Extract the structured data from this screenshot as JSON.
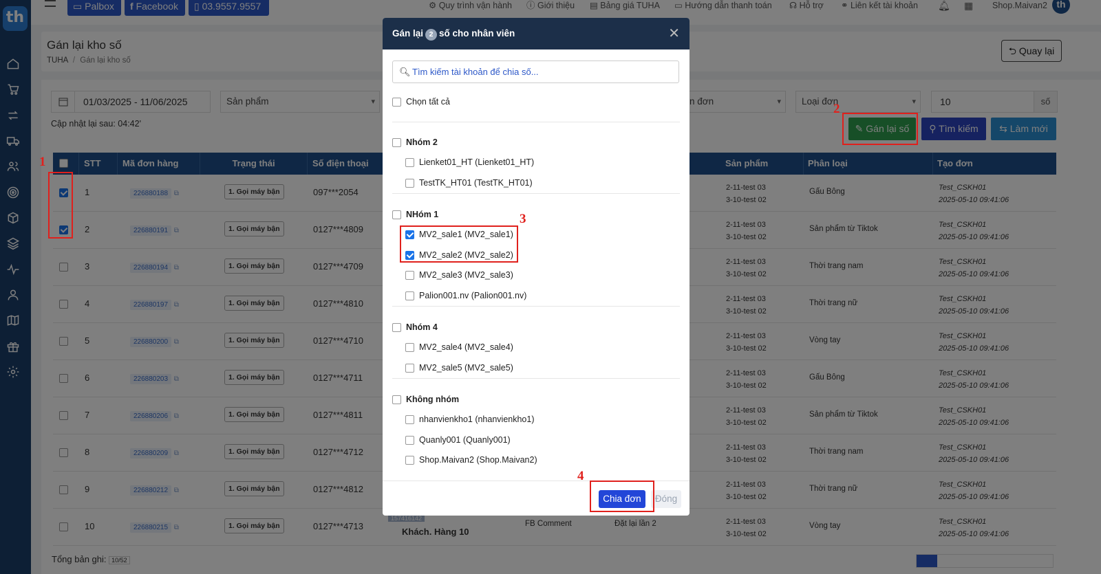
{
  "topbar": {
    "buttons": [
      "Palbox",
      "Facebook",
      "03.9557.9557"
    ],
    "links": [
      "Quy trình vận hành",
      "Giới thiệu",
      "Bảng giá TUHA",
      "Hướng dẫn thanh toán",
      "Hỗ trợ",
      "Liên kết tài khoản"
    ],
    "user": "Shop.Maivan2",
    "user_avatar": "th"
  },
  "sidebar": {
    "logo": "th",
    "icons": [
      "home-icon",
      "cart-icon",
      "exchange-icon",
      "truck-icon",
      "users-icon",
      "target-icon",
      "box-icon",
      "layers-icon",
      "activity-icon",
      "user-icon",
      "map-icon",
      "gift-icon",
      "gear-icon"
    ]
  },
  "page": {
    "title": "Gán lại kho số",
    "breadcrumb_root": "TUHA",
    "breadcrumb_sep": "/",
    "breadcrumb_current": "Gán lại kho số",
    "back_label": "Quay lại"
  },
  "filters": {
    "date_range": "01/03/2025 - 11/06/2025",
    "product_placeholder": "Sản phẩm",
    "order_source_partial": "n đơn",
    "order_type_placeholder": "Loại đơn",
    "count_value": "10",
    "count_suffix": "số",
    "update_text": "Cập nhật lại sau: 04:42'"
  },
  "actions": {
    "reassign": "Gán lại số",
    "search": "Tìm kiếm",
    "reset": "Làm mới"
  },
  "table": {
    "headers": [
      "STT",
      "Mã đơn hàng",
      "Trạng thái",
      "Số điện thoại",
      "Sản phẩm",
      "Phân loại",
      "Tạo đơn"
    ],
    "rows": [
      {
        "stt": "1",
        "code": "226880188",
        "status": "1. Gọi máy bận",
        "phone": "097***2054",
        "prod1": "2-11-test 03",
        "prod2": "3-10-test 02",
        "cat": "Gấu Bông",
        "creator": "Test_CSKH01",
        "created": "2025-05-10 09:41:06",
        "checked": true
      },
      {
        "stt": "2",
        "code": "226880191",
        "status": "1. Gọi máy bận",
        "phone": "0127***4809",
        "prod1": "2-11-test 03",
        "prod2": "3-10-test 02",
        "cat": "Sản phẩm từ Tiktok",
        "creator": "Test_CSKH01",
        "created": "2025-05-10 09:41:06",
        "checked": true
      },
      {
        "stt": "3",
        "code": "226880194",
        "status": "1. Gọi máy bận",
        "phone": "0127***4709",
        "prod1": "2-11-test 03",
        "prod2": "3-10-test 02",
        "cat": "Thời trang nam",
        "creator": "Test_CSKH01",
        "created": "2025-05-10 09:41:06",
        "checked": false
      },
      {
        "stt": "4",
        "code": "226880197",
        "status": "1. Gọi máy bận",
        "phone": "0127***4810",
        "prod1": "2-11-test 03",
        "prod2": "3-10-test 02",
        "cat": "Thời trang nữ",
        "creator": "Test_CSKH01",
        "created": "2025-05-10 09:41:06",
        "checked": false
      },
      {
        "stt": "5",
        "code": "226880200",
        "status": "1. Gọi máy bận",
        "phone": "0127***4710",
        "prod1": "2-11-test 03",
        "prod2": "3-10-test 02",
        "cat": "Vòng tay",
        "creator": "Test_CSKH01",
        "created": "2025-05-10 09:41:06",
        "checked": false
      },
      {
        "stt": "6",
        "code": "226880203",
        "status": "1. Gọi máy bận",
        "phone": "0127***4711",
        "prod1": "2-11-test 03",
        "prod2": "3-10-test 02",
        "cat": "Gấu Bông",
        "creator": "Test_CSKH01",
        "created": "2025-05-10 09:41:06",
        "checked": false
      },
      {
        "stt": "7",
        "code": "226880206",
        "status": "1. Gọi máy bận",
        "phone": "0127***4811",
        "prod1": "2-11-test 03",
        "prod2": "3-10-test 02",
        "cat": "Sản phẩm từ Tiktok",
        "creator": "Test_CSKH01",
        "created": "2025-05-10 09:41:06",
        "checked": false
      },
      {
        "stt": "8",
        "code": "226880209",
        "status": "1. Gọi máy bận",
        "phone": "0127***4712",
        "prod1": "2-11-test 03",
        "prod2": "3-10-test 02",
        "cat": "Thời trang nam",
        "creator": "Test_CSKH01",
        "created": "2025-05-10 09:41:06",
        "checked": false
      },
      {
        "stt": "9",
        "code": "226880212",
        "status": "1. Gọi máy bận",
        "phone": "0127***4812",
        "prod1": "2-11-test 03",
        "prod2": "3-10-test 02",
        "cat": "Thời trang nữ",
        "creator": "Test_CSKH01",
        "created": "2025-05-10 09:41:06",
        "checked": false
      },
      {
        "stt": "10",
        "code": "226880215",
        "status": "1. Gọi máy bận",
        "phone": "0127***4713",
        "prod1": "2-11-test 03",
        "prod2": "3-10-test 02",
        "cat": "Vòng tay",
        "creator": "Test_CSKH01",
        "created": "2025-05-10 09:41:06",
        "checked": false
      }
    ],
    "peek": {
      "code": "157416142",
      "customer": "Khách. Hàng 10",
      "source": "FB Comment",
      "attempt": "Đặt lại lần 2"
    },
    "footer_label": "Tổng bản ghi:",
    "footer_count": "10/52"
  },
  "modal": {
    "title_before": "Gán lại",
    "count": "2",
    "title_after": "số cho nhân viên",
    "search_placeholder": "Tìm kiếm tài khoản để chia số...",
    "select_all": "Chọn tất cả",
    "groups": [
      {
        "name": "Nhóm 2",
        "members": [
          {
            "label": "Lienket01_HT (Lienket01_HT)",
            "checked": false
          },
          {
            "label": "TestTK_HT01 (TestTK_HT01)",
            "checked": false
          }
        ]
      },
      {
        "name": "NHóm 1",
        "members": [
          {
            "label": "MV2_sale1 (MV2_sale1)",
            "checked": true
          },
          {
            "label": "MV2_sale2 (MV2_sale2)",
            "checked": true
          },
          {
            "label": "MV2_sale3 (MV2_sale3)",
            "checked": false
          },
          {
            "label": "Palion001.nv (Palion001.nv)",
            "checked": false
          }
        ]
      },
      {
        "name": "Nhóm 4",
        "members": [
          {
            "label": "MV2_sale4 (MV2_sale4)",
            "checked": false
          },
          {
            "label": "MV2_sale5 (MV2_sale5)",
            "checked": false
          }
        ]
      },
      {
        "name": "Không nhóm",
        "members": [
          {
            "label": "nhanvienkho1 (nhanvienkho1)",
            "checked": false
          },
          {
            "label": "Quanly001 (Quanly001)",
            "checked": false
          },
          {
            "label": "Shop.Maivan2 (Shop.Maivan2)",
            "checked": false
          }
        ]
      }
    ],
    "submit": "Chia đơn",
    "close": "Đóng"
  },
  "annotations": [
    "1",
    "2",
    "3",
    "4"
  ],
  "colors": {
    "sidebar": "#1b3f6b",
    "header": "#1f4f8a",
    "modal_header": "#1c2f49",
    "primary": "#2d58c8",
    "success": "#2e9e4f",
    "info": "#2b8ed3",
    "highlight": "#e0201c"
  }
}
